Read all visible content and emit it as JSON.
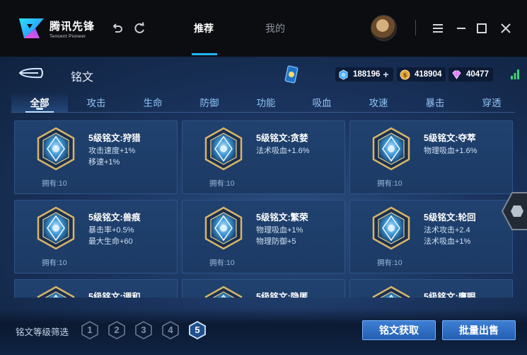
{
  "app": {
    "logo_cn": "腾讯先锋",
    "logo_en": "Tencent Pioneer",
    "nav_tabs": [
      "推荐",
      "我的"
    ],
    "active_nav": "推荐"
  },
  "header": {
    "title": "铭文",
    "currencies": [
      {
        "icon": "gem-coin-icon",
        "value": "188196",
        "plus": "+"
      },
      {
        "icon": "gold-coin-icon",
        "value": "418904"
      },
      {
        "icon": "diamond-icon",
        "value": "40477"
      }
    ]
  },
  "categories": [
    "全部",
    "攻击",
    "生命",
    "防御",
    "功能",
    "吸血",
    "攻速",
    "暴击",
    "穿透"
  ],
  "active_category": "全部",
  "cards": [
    {
      "name": "5级铭文:狩猎",
      "stats": [
        "攻击速度+1%",
        "移速+1%"
      ],
      "owned": "拥有:10",
      "color": "#3a8fd0"
    },
    {
      "name": "5级铭文:贪婪",
      "stats": [
        "法术吸血+1.6%"
      ],
      "owned": "拥有:10",
      "color": "#4da6e0"
    },
    {
      "name": "5级铭文:夺萃",
      "stats": [
        "物理吸血+1.6%"
      ],
      "owned": "拥有:10",
      "color": "#2fb4c8"
    },
    {
      "name": "5级铭文:兽痕",
      "stats": [
        "暴击率+0.5%",
        "最大生命+60"
      ],
      "owned": "拥有:10",
      "color": "#4aa0d8"
    },
    {
      "name": "5级铭文:繁荣",
      "stats": [
        "物理吸血+1%",
        "物理防御+5"
      ],
      "owned": "拥有:10",
      "color": "#62b8e8"
    },
    {
      "name": "5级铭文:轮回",
      "stats": [
        "法术攻击+2.4",
        "法术吸血+1%"
      ],
      "owned": "拥有:10",
      "color": "#3aa8e0"
    },
    {
      "name": "5级铭文:调和",
      "stats": [],
      "owned": "",
      "color": "#3a8fd0"
    },
    {
      "name": "5级铭文:隐匿",
      "stats": [],
      "owned": "",
      "color": "#4da6e0"
    },
    {
      "name": "5级铭文:鹰眼",
      "stats": [],
      "owned": "",
      "color": "#7fb26a"
    }
  ],
  "footer": {
    "filter_label": "铭文等级筛选",
    "levels": [
      "1",
      "2",
      "3",
      "4",
      "5"
    ],
    "active_level": "5",
    "get_button": "铭文获取",
    "sell_button": "批量出售"
  },
  "colors": {
    "accent": "#1fb5ff",
    "gold": "#d8b567",
    "panel": "#1c3a64"
  }
}
